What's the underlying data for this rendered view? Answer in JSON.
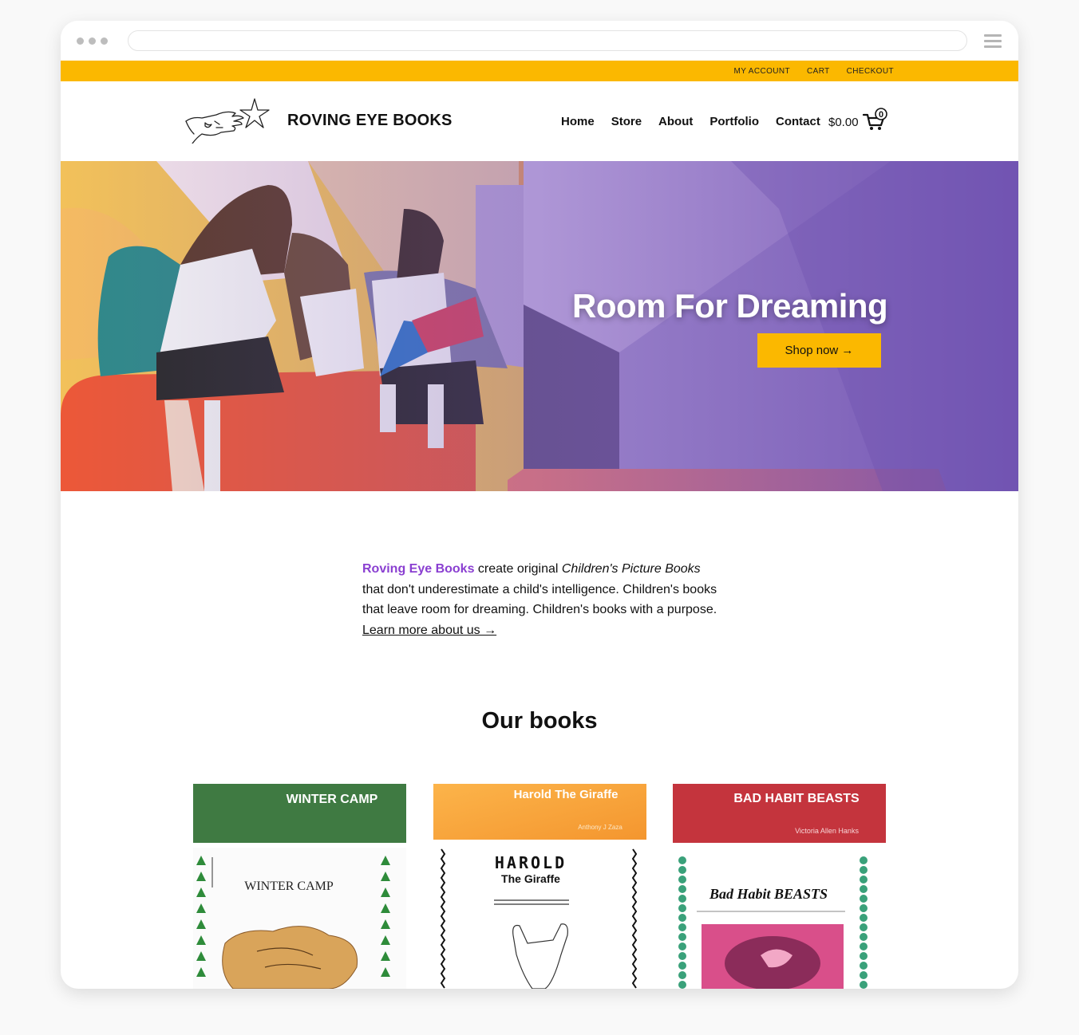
{
  "topbar": {
    "links": [
      "MY ACCOUNT",
      "CART",
      "CHECKOUT"
    ]
  },
  "header": {
    "site_title": "ROVING EYE BOOKS",
    "nav": [
      "Home",
      "Store",
      "About",
      "Portfolio",
      "Contact"
    ],
    "cart_total": "$0.00",
    "cart_count": "0"
  },
  "hero": {
    "title": "Room For Dreaming",
    "button": "Shop now →"
  },
  "intro": {
    "brand": "Roving Eye Books",
    "text1": " create original ",
    "italic": "Children's Picture Books",
    "text2": " that don't underestimate a child's intelligence. Children's books that leave room for dreaming. Children's books with a purpose. ",
    "link": "Learn more about us →"
  },
  "books": {
    "heading": "Our books",
    "items": [
      {
        "banner": "WINTER CAMP",
        "author": "",
        "cover_title": "WINTER CAMP",
        "color": "#3f7a42"
      },
      {
        "banner": "Harold The Giraffe",
        "author": "Anthony J Zaza",
        "cover_title": "HAROLD",
        "cover_subtitle": "The Giraffe",
        "color": "#f7a43a"
      },
      {
        "banner": "BAD HABIT BEASTS",
        "author": "Victoria Allen Hanks",
        "cover_title": "Bad Habit BEASTS",
        "color": "#c4343d"
      }
    ]
  },
  "colors": {
    "accent_yellow": "#fbb800",
    "brand_purple": "#8a3fd1"
  }
}
